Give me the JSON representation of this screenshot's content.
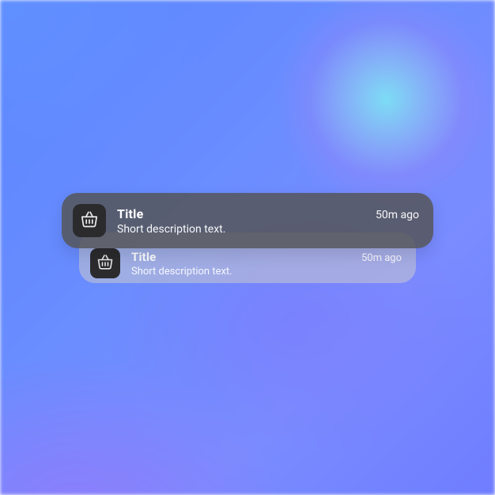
{
  "notifications": [
    {
      "icon": "shopping-basket",
      "title": "Title",
      "description": "Short description text.",
      "time": "50m ago"
    },
    {
      "icon": "shopping-basket",
      "title": "Title",
      "description": "Short description text.",
      "time": "50m ago"
    }
  ]
}
